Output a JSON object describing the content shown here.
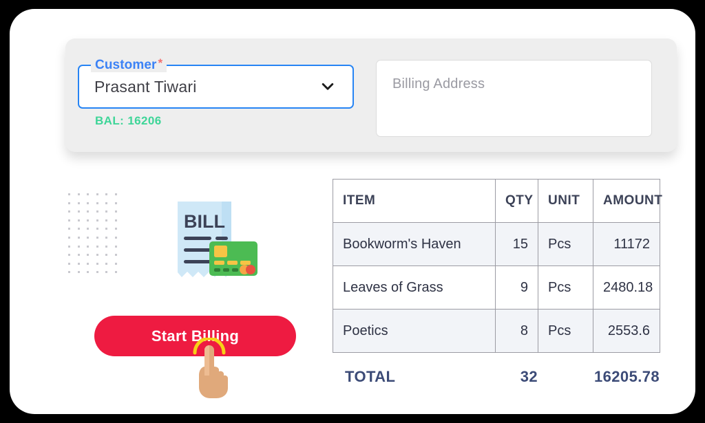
{
  "theme": {
    "background": "#000000",
    "card_background": "#ffffff",
    "panel_background": "#eeeeee",
    "accent_blue": "#3B82F6",
    "accent_red": "#EE1B41",
    "accent_green": "#3ED598",
    "required_star": "#F2706E",
    "table_border": "#9b9ba3",
    "row_stripe": "#f2f4f8",
    "total_text": "#3C4B77"
  },
  "form": {
    "customer": {
      "label": "Customer",
      "required_marker": "*",
      "value": "Prasant Tiwari",
      "caret_icon": "chevron-down-icon",
      "balance_text": "BAL: 16206"
    },
    "billing_address": {
      "placeholder": "Billing Address",
      "value": ""
    }
  },
  "illustration": {
    "bill_text": "BILL",
    "receipt_color": "#CFE8F7",
    "card_color": "#4CBB53",
    "chip_color": "#F6C445"
  },
  "actions": {
    "start_billing_label": "Start Billing",
    "cursor_icon": "pointing-hand-icon"
  },
  "invoice": {
    "columns": [
      "ITEM",
      "QTY",
      "UNIT",
      "AMOUNT"
    ],
    "rows": [
      {
        "item": "Bookworm's Haven",
        "qty": "15",
        "unit": "Pcs",
        "amount": "11172"
      },
      {
        "item": "Leaves of Grass",
        "qty": "9",
        "unit": "Pcs",
        "amount": "2480.18"
      },
      {
        "item": "Poetics",
        "qty": "8",
        "unit": "Pcs",
        "amount": "2553.6"
      }
    ],
    "total": {
      "label": "TOTAL",
      "qty": "32",
      "amount": "16205.78"
    }
  }
}
